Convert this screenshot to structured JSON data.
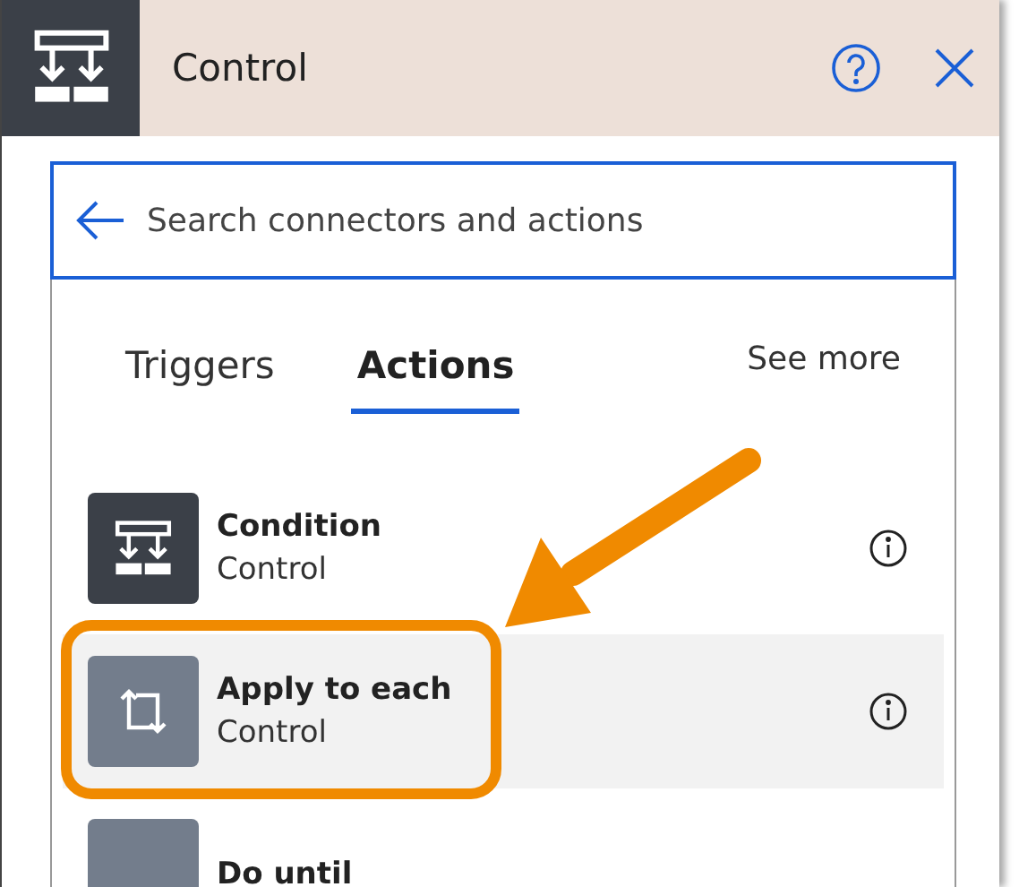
{
  "header": {
    "title": "Control"
  },
  "search": {
    "placeholder": "Search connectors and actions"
  },
  "tabs": [
    {
      "label": "Triggers",
      "selected": false
    },
    {
      "label": "Actions",
      "selected": true
    }
  ],
  "see_more": "See more",
  "actions": [
    {
      "kind": "condition",
      "title": "Condition",
      "subtitle": "Control",
      "selected": false
    },
    {
      "kind": "loop",
      "title": "Apply to each",
      "subtitle": "Control",
      "selected": true
    },
    {
      "kind": "do-until",
      "title": "Do until",
      "selected": false
    }
  ]
}
